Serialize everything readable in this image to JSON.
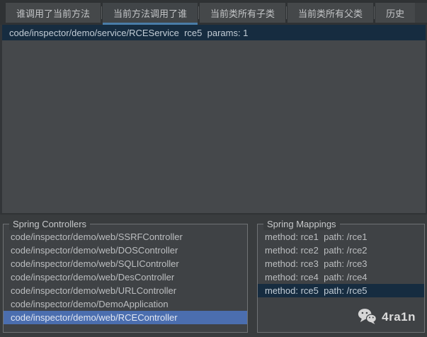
{
  "tabs": {
    "selected_index": 1,
    "items": [
      {
        "label": "谁调用了当前方法",
        "selected": false
      },
      {
        "label": "当前方法调用了谁",
        "selected": true
      },
      {
        "label": "当前类所有子类",
        "selected": false
      },
      {
        "label": "当前类所有父类",
        "selected": false
      },
      {
        "label": "历史",
        "selected": false
      }
    ]
  },
  "call_results": {
    "items": [
      {
        "text": "code/inspector/demo/service/RCEService  rce5  params: 1",
        "selected": true
      }
    ]
  },
  "spring_controllers": {
    "title": "Spring Controllers",
    "items": [
      {
        "text": "code/inspector/demo/web/SSRFController",
        "selected": false
      },
      {
        "text": "code/inspector/demo/web/DOSController",
        "selected": false
      },
      {
        "text": "code/inspector/demo/web/SQLIController",
        "selected": false
      },
      {
        "text": "code/inspector/demo/web/DesController",
        "selected": false
      },
      {
        "text": "code/inspector/demo/web/URLController",
        "selected": false
      },
      {
        "text": "code/inspector/demo/DemoApplication",
        "selected": false
      },
      {
        "text": "code/inspector/demo/web/RCEController",
        "selected": true
      }
    ]
  },
  "spring_mappings": {
    "title": "Spring Mappings",
    "items": [
      {
        "text": "method: rce1  path: /rce1",
        "selected": false
      },
      {
        "text": "method: rce2  path: /rce2",
        "selected": false
      },
      {
        "text": "method: rce3  path: /rce3",
        "selected": false
      },
      {
        "text": "method: rce4  path: /rce4",
        "selected": false
      },
      {
        "text": "method: rce5  path: /rce5",
        "selected": true
      }
    ]
  },
  "watermark": {
    "label": "4ra1n",
    "icon": "wechat-icon"
  },
  "colors": {
    "tab_underline": "#4a7da8",
    "selection_blue": "#4b6eaf",
    "selection_navy": "#162c40",
    "panel_bg": "#45484b",
    "bottom_bg": "#393c3e"
  }
}
